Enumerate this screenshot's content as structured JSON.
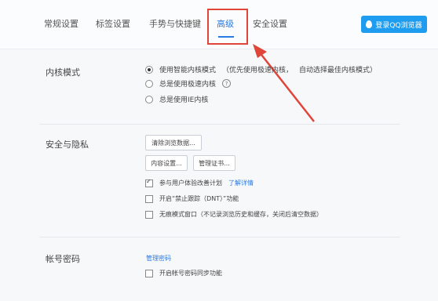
{
  "tabs": [
    {
      "label": "常规设置",
      "active": false
    },
    {
      "label": "标签设置",
      "active": false
    },
    {
      "label": "手势与快捷键",
      "active": false
    },
    {
      "label": "高级",
      "active": true
    },
    {
      "label": "安全设置",
      "active": false
    }
  ],
  "login_button": {
    "label": "登录QQ浏览器",
    "icon": "drop-icon"
  },
  "kernel": {
    "title": "内核模式",
    "options": [
      {
        "label": "使用智能内核模式",
        "note": "（优先使用极速内核，",
        "link": "自动选择最佳内核模式）",
        "selected": true
      },
      {
        "label": "总是使用极速内核",
        "help": "?",
        "selected": false
      },
      {
        "label": "总是使用IE内核",
        "selected": false
      }
    ]
  },
  "security": {
    "title": "安全与隐私",
    "clear_button": "清除浏览数据...",
    "content_button": "内容设置...",
    "cert_button": "管理证书...",
    "checks": [
      {
        "label": "参与用户体验改善计划",
        "link": "了解详情",
        "checked": true
      },
      {
        "label": "开启“禁止跟踪（DNT）”功能",
        "checked": false
      },
      {
        "label": "无痕模式窗口（不记录浏览历史和缓存，关闭后清空数据）",
        "checked": false
      }
    ]
  },
  "account": {
    "title": "帐号密码",
    "manage_link": "管理密码",
    "checks": [
      {
        "label": "开启帐号密码同步功能",
        "checked": false
      }
    ]
  },
  "colors": {
    "accent": "#2a7ae2",
    "highlight": "#e0453a",
    "login_bg": "#1d9cf0"
  }
}
